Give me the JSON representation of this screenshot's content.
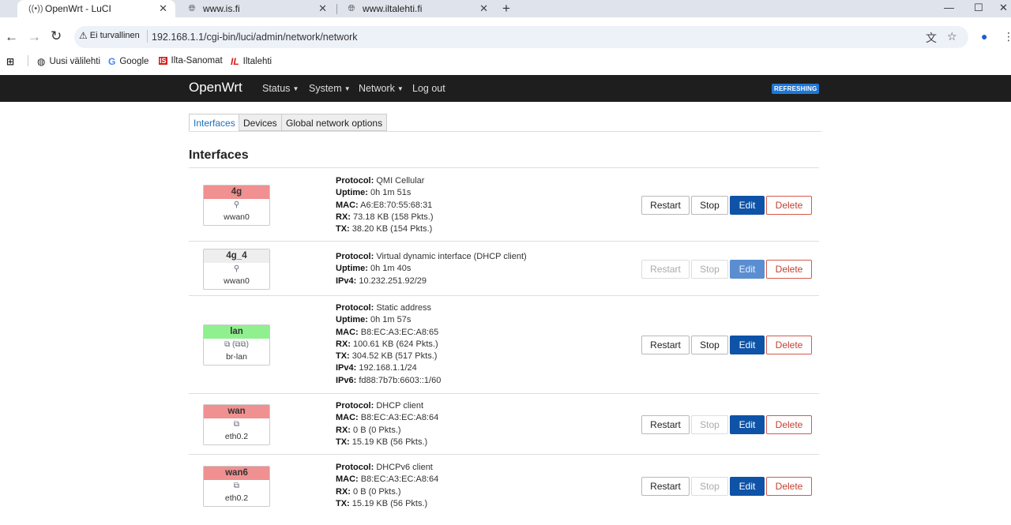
{
  "browser": {
    "tabs": [
      {
        "title": "OpenWrt - LuCI",
        "icon": "radio-icon"
      },
      {
        "title": "www.is.fi",
        "icon": "globe-icon"
      },
      {
        "title": "www.iltalehti.fi",
        "icon": "globe-icon"
      }
    ],
    "security_label": "Ei turvallinen",
    "url": "192.168.1.1/cgi-bin/luci/admin/network/network",
    "bookmarks": [
      {
        "label": "Uusi välilehti",
        "icon": "globe-icon"
      },
      {
        "label": "Google",
        "icon": "google-icon"
      },
      {
        "label": "Ilta-Sanomat",
        "icon": "is-logo-icon"
      },
      {
        "label": "Iltalehti",
        "icon": "il-logo-icon"
      }
    ]
  },
  "header": {
    "brand": "OpenWrt",
    "menu": [
      "Status",
      "System",
      "Network",
      "Log out"
    ],
    "badge": "REFRESHING"
  },
  "tabs": [
    "Interfaces",
    "Devices",
    "Global network options"
  ],
  "section_title": "Interfaces",
  "buttons": {
    "restart": "Restart",
    "stop": "Stop",
    "edit": "Edit",
    "delete": "Delete"
  },
  "colors": {
    "down": "#f09090",
    "up": "#90f090",
    "neutral": "#eeeeee",
    "edit": "#0e53a7",
    "delete": "#c4402f"
  },
  "interfaces": [
    {
      "name": "4g",
      "device": "wwan0",
      "status_color": "#f09090",
      "icon": "wireless-icon",
      "info": [
        {
          "k": "Protocol:",
          "v": "QMI Cellular"
        },
        {
          "k": "Uptime:",
          "v": "0h 1m 51s"
        },
        {
          "k": "MAC:",
          "v": "A6:E8:70:55:68:31"
        },
        {
          "k": "RX:",
          "v": "73.18 KB (158 Pkts.)"
        },
        {
          "k": "TX:",
          "v": "38.20 KB (154 Pkts.)"
        }
      ],
      "restart_enabled": true,
      "stop_enabled": true,
      "edit_enabled": true
    },
    {
      "name": "4g_4",
      "device": "wwan0",
      "status_color": "#eeeeee",
      "icon": "wireless-icon",
      "info": [
        {
          "k": "Protocol:",
          "v": "Virtual dynamic interface (DHCP client)"
        },
        {
          "k": "Uptime:",
          "v": "0h 1m 40s"
        },
        {
          "k": "IPv4:",
          "v": "10.232.251.92/29"
        }
      ],
      "restart_enabled": false,
      "stop_enabled": false,
      "edit_enabled": false
    },
    {
      "name": "lan",
      "device": "br-lan",
      "status_color": "#90f090",
      "icon": "bridge-icon",
      "info": [
        {
          "k": "Protocol:",
          "v": "Static address"
        },
        {
          "k": "Uptime:",
          "v": "0h 1m 57s"
        },
        {
          "k": "MAC:",
          "v": "B8:EC:A3:EC:A8:65"
        },
        {
          "k": "RX:",
          "v": "100.61 KB (624 Pkts.)"
        },
        {
          "k": "TX:",
          "v": "304.52 KB (517 Pkts.)"
        },
        {
          "k": "IPv4:",
          "v": "192.168.1.1/24"
        },
        {
          "k": "IPv6:",
          "v": "fd88:7b7b:6603::1/60"
        }
      ],
      "restart_enabled": true,
      "stop_enabled": true,
      "edit_enabled": true
    },
    {
      "name": "wan",
      "device": "eth0.2",
      "status_color": "#f09090",
      "icon": "ethernet-icon",
      "info": [
        {
          "k": "Protocol:",
          "v": "DHCP client"
        },
        {
          "k": "MAC:",
          "v": "B8:EC:A3:EC:A8:64"
        },
        {
          "k": "RX:",
          "v": "0 B (0 Pkts.)"
        },
        {
          "k": "TX:",
          "v": "15.19 KB (56 Pkts.)"
        }
      ],
      "restart_enabled": true,
      "stop_enabled": false,
      "edit_enabled": true
    },
    {
      "name": "wan6",
      "device": "eth0.2",
      "status_color": "#f09090",
      "icon": "ethernet-icon",
      "info": [
        {
          "k": "Protocol:",
          "v": "DHCPv6 client"
        },
        {
          "k": "MAC:",
          "v": "B8:EC:A3:EC:A8:64"
        },
        {
          "k": "RX:",
          "v": "0 B (0 Pkts.)"
        },
        {
          "k": "TX:",
          "v": "15.19 KB (56 Pkts.)"
        }
      ],
      "restart_enabled": true,
      "stop_enabled": false,
      "edit_enabled": true
    }
  ]
}
